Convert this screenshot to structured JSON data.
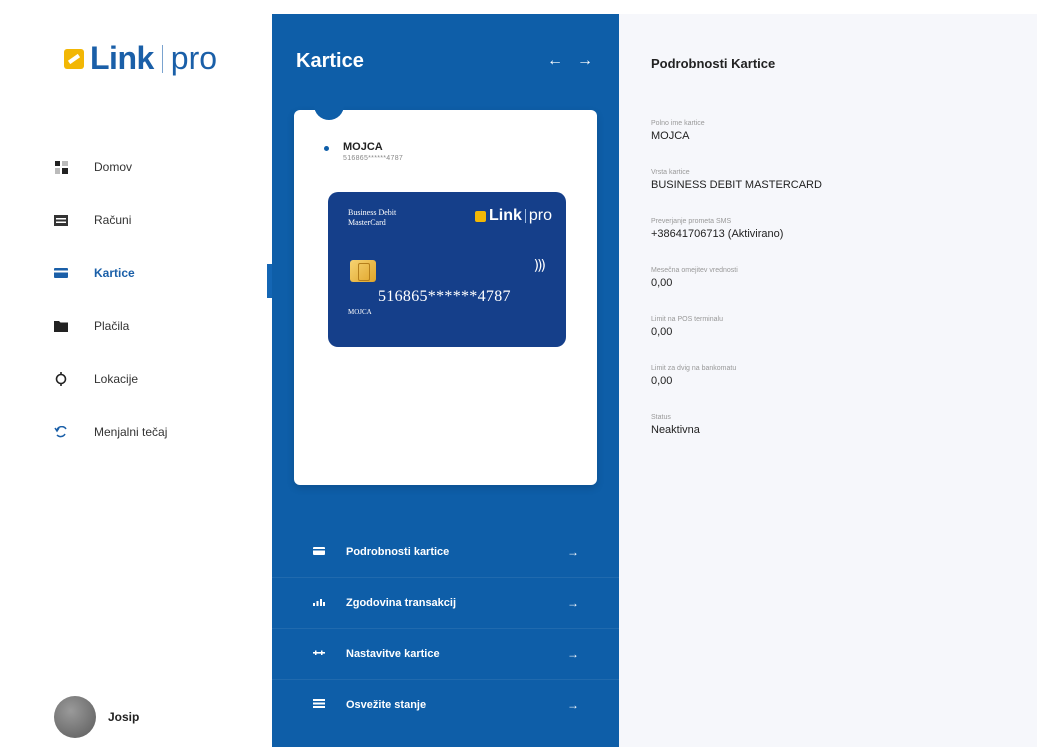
{
  "brand": {
    "word": "Link",
    "suffix": "pro",
    "accent": "#1a5fa8",
    "panel_color": "#0e5ea8",
    "logo_color": "#f2b705"
  },
  "sidebar": {
    "items": [
      {
        "label": "Domov",
        "icon": "dashboard-icon"
      },
      {
        "label": "Računi",
        "icon": "accounts-icon"
      },
      {
        "label": "Kartice",
        "icon": "card-icon",
        "active": true
      },
      {
        "label": "Plačila",
        "icon": "folder-icon"
      },
      {
        "label": "Lokacije",
        "icon": "location-icon"
      },
      {
        "label": "Menjalni tečaj",
        "icon": "exchange-icon"
      }
    ],
    "user": {
      "name": "Josip"
    }
  },
  "cards_panel": {
    "title": "Kartice",
    "prev_icon": "arrow-left-icon",
    "next_icon": "arrow-right-icon",
    "selected_card": {
      "name": "MOJCA",
      "masked_number": "516865******4787"
    },
    "bank_card": {
      "type": "Business Debit MasterCard",
      "brand_word": "Link",
      "brand_suffix": "pro",
      "number": "516865******4787",
      "holder": "MOJCA"
    },
    "menu": [
      {
        "label": "Podrobnosti kartice",
        "icon": "card-icon"
      },
      {
        "label": "Zgodovina transakcij",
        "icon": "transactions-icon"
      },
      {
        "label": "Nastavitve kartice",
        "icon": "settings-icon"
      },
      {
        "label": "Osvežite stanje",
        "icon": "balance-icon"
      }
    ]
  },
  "details": {
    "title": "Podrobnosti Kartice",
    "fields": [
      {
        "label": "Polno ime kartice",
        "value": "MOJCA"
      },
      {
        "label": "Vrsta kartice",
        "value": "BUSINESS DEBIT MASTERCARD"
      },
      {
        "label": "Preverjanje prometa SMS",
        "value": "+38641706713 (Aktivirano)"
      },
      {
        "label": "Mesečna omejitev vrednosti",
        "value": "0,00"
      },
      {
        "label": "Limit na POS terminalu",
        "value": "0,00"
      },
      {
        "label": "Limit za dvig na bankomatu",
        "value": "0,00"
      },
      {
        "label": "Status",
        "value": "Neaktivna"
      }
    ]
  }
}
